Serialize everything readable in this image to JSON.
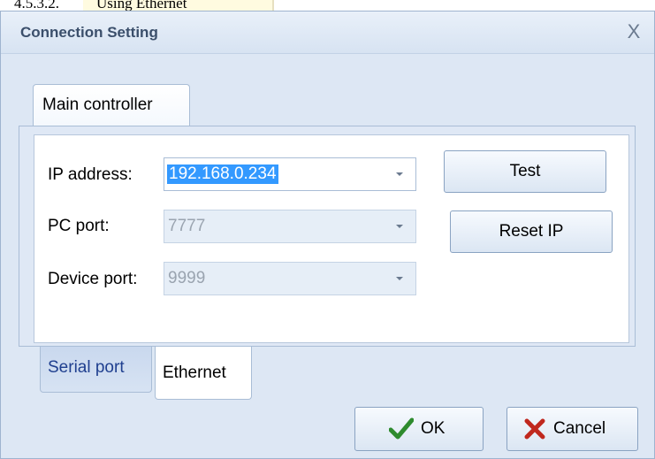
{
  "doc_header": {
    "number": "4.5.3.2.",
    "text": "Using Ethernet"
  },
  "dialog": {
    "title": "Connection Setting",
    "close_symbol": "X",
    "main_tab": "Main controller",
    "fields": {
      "ip_label": "IP address:",
      "ip_value": "192.168.0.234",
      "pc_port_label": "PC port:",
      "pc_port_value": "7777",
      "device_port_label": "Device port:",
      "device_port_value": "9999"
    },
    "buttons": {
      "test": "Test",
      "reset_ip": "Reset IP",
      "ok": "OK",
      "cancel": "Cancel"
    },
    "bottom_tabs": [
      "Serial port",
      "Ethernet"
    ],
    "selected_bottom_tab": "Ethernet",
    "icons": {
      "ok": "check-icon",
      "cancel": "x-icon",
      "close": "close-icon",
      "combo": "chevron-down-icon"
    },
    "colors": {
      "selection": "#3399ff",
      "ok_check": "#2e8b2e",
      "cancel_x": "#c0281e"
    }
  }
}
